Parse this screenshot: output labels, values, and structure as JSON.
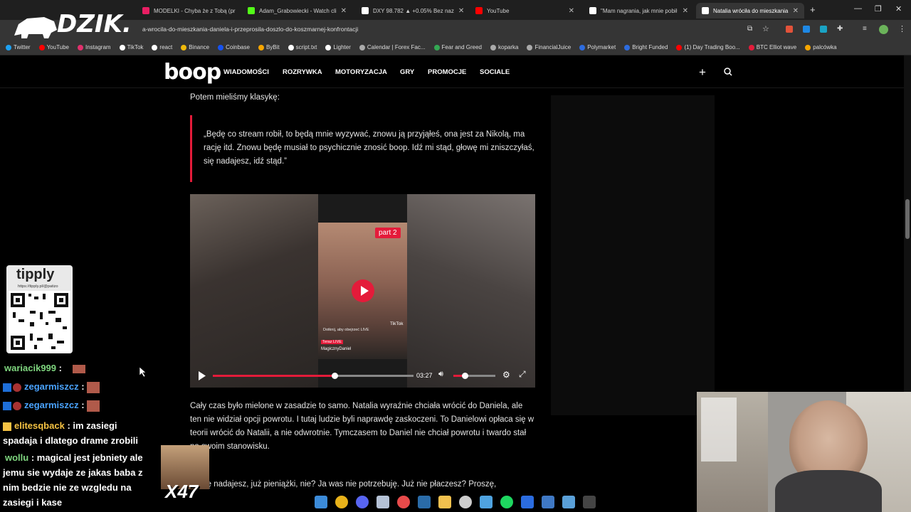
{
  "browser": {
    "tabs": [
      {
        "label": "MODELKI - Chyba że z Tobą (pr",
        "color": "#e91e63"
      },
      {
        "label": "Adam_Grabowiecki - Watch cli",
        "color": "#53fc18"
      },
      {
        "label": "DXY 98.782 ▲ +0.05% Bez naz",
        "color": "#ffffff"
      },
      {
        "label": "YouTube",
        "color": "#ff0000"
      },
      {
        "label": "\"Mam nagrania, jak mnie pobił",
        "color": "#ffffff"
      },
      {
        "label": "Natalia wróciła do mieszkania",
        "color": "#ffffff"
      }
    ],
    "url": "a-wrocila-do-mieszkania-daniela-i-przeprosila-doszlo-do-koszmarnej-konfrontacji",
    "bookmarks": [
      {
        "label": "Twitter",
        "color": "#1da1f2"
      },
      {
        "label": "YouTube",
        "color": "#ff0000"
      },
      {
        "label": "Instagram",
        "color": "#e1306c"
      },
      {
        "label": "TikTok",
        "color": "#ffffff"
      },
      {
        "label": "react",
        "color": "#ffffff"
      },
      {
        "label": "Binance",
        "color": "#f0b90b"
      },
      {
        "label": "Coinbase",
        "color": "#1652f0"
      },
      {
        "label": "ByBit",
        "color": "#f7a600"
      },
      {
        "label": "script.txt",
        "color": "#ffffff"
      },
      {
        "label": "Lighter",
        "color": "#ffffff"
      },
      {
        "label": "Calendar | Forex Fac...",
        "color": "#aaaaaa"
      },
      {
        "label": "Fear and Greed",
        "color": "#34a853"
      },
      {
        "label": "koparka",
        "color": "#aaaaaa"
      },
      {
        "label": "FinancialJuice",
        "color": "#aaaaaa"
      },
      {
        "label": "Polymarket",
        "color": "#2d6cdf"
      },
      {
        "label": "Bright Funded",
        "color": "#2d6cdf"
      },
      {
        "label": "(1) Day Trading Boo...",
        "color": "#ff0000"
      },
      {
        "label": "BTC Elliot wave",
        "color": "#e41b3a"
      },
      {
        "label": "palcówka",
        "color": "#f7a600"
      }
    ]
  },
  "stream_overlay": {
    "logo": "DZIK.",
    "tipply": {
      "title": "tipply",
      "url": "https://tipply.pl/@patizo"
    },
    "chat": [
      {
        "user": "wariacik999",
        "message": "",
        "user_color": "#7fd67f"
      },
      {
        "user": "zegarmiszcz",
        "message": "",
        "user_color": "#4aa3ff"
      },
      {
        "user": "zegarmiszcz",
        "message": "",
        "user_color": "#4aa3ff"
      },
      {
        "user": "elitesqback",
        "message": "im zasiegi spadaja i dlatego drame zrobili",
        "user_color": "#f6c343"
      },
      {
        "user": "wollu",
        "message": "magical jest jebniety ale jemu sie wydaje ze jakas baba z nim bedzie nie ze wzgledu na zasiegi i kase",
        "user_color": "#7fd67f"
      }
    ],
    "emote_count": "X47"
  },
  "site": {
    "logo": "boop",
    "nav": [
      "WIADOMOŚCI",
      "ROZRYWKA",
      "MOTORYZACJA",
      "GRY",
      "PROMOCJE",
      "SOCIALE"
    ],
    "paragraph1": "Potem mieliśmy klasykę:",
    "quote": "„Będę co stream robił, to będą mnie wyzywać, znowu ją przyjąłeś, ona jest za Nikolą, ma rację itd. Znowu będę musiał to psychicznie znosić boop. Idź mi stąd, głowę mi zniszczyłaś, się nadajesz, idź stąd.”",
    "video": {
      "badge": "part 2",
      "time": "03:27",
      "progress": 0.6,
      "volume": 0.45,
      "tiktok_label": "TikTok",
      "overlay_text": "Dotknij, aby obejrzeć LIVE",
      "live_label": "Teraz LIVE",
      "user_label": "MagicznyDaniel"
    },
    "paragraph2": "Cały czas było mielone w zasadzie to samo. Natalia wyraźnie chciała wrócić do Daniela, ale ten nie widział opcji powrotu. I tutaj ludzie byli naprawdę zaskoczeni. To Danielowi opłaca się w teorii wrócić do Natalii, a nie odwrotnie. Tymczasem to Daniel nie chciał powrotu i twardo stał na swoim stanowisku.",
    "paragraph3": "Ty się nadajesz, już pieniążki, nie? Ja was nie potrzebuję. Już nie płaczesz? Proszę,"
  }
}
